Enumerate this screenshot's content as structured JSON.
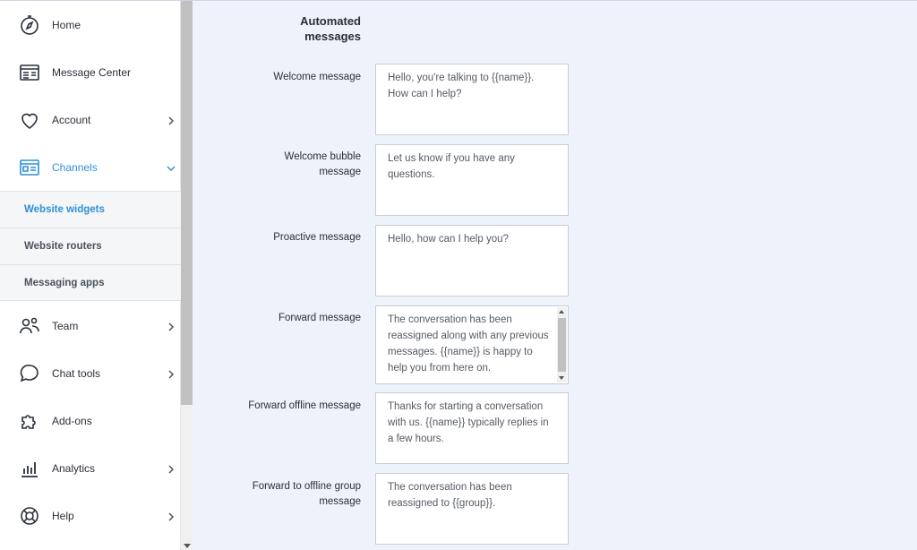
{
  "sidebar": {
    "items": [
      {
        "label": "Home",
        "icon": "compass-icon"
      },
      {
        "label": "Message Center",
        "icon": "message-center-icon"
      },
      {
        "label": "Account",
        "icon": "heart-icon"
      },
      {
        "label": "Channels",
        "icon": "channels-icon"
      },
      {
        "label": "Team",
        "icon": "team-icon"
      },
      {
        "label": "Chat tools",
        "icon": "chat-bubble-icon"
      },
      {
        "label": "Add-ons",
        "icon": "puzzle-icon"
      },
      {
        "label": "Analytics",
        "icon": "bar-chart-icon"
      },
      {
        "label": "Help",
        "icon": "lifebuoy-icon"
      }
    ],
    "channels_sub": [
      {
        "label": "Website widgets"
      },
      {
        "label": "Website routers"
      },
      {
        "label": "Messaging apps"
      }
    ]
  },
  "main": {
    "section_title_line1": "Automated",
    "section_title_line2": "messages",
    "fields": [
      {
        "label": "Welcome message",
        "value": "Hello, you're talking to {{name}}. How can I help?"
      },
      {
        "label_line1": "Welcome bubble",
        "label_line2": "message",
        "value": "Let us know if you have any questions."
      },
      {
        "label": "Proactive message",
        "value": "Hello, how can I help you?"
      },
      {
        "label": "Forward message",
        "value": "The conversation has been reassigned along with any previous messages. {{name}} is happy to help you from here on."
      },
      {
        "label": "Forward offline message",
        "value": "Thanks for starting a conversation with us. {{name}} typically replies in a few hours."
      },
      {
        "label_line1": "Forward to offline group",
        "label_line2": "message",
        "value": "The conversation has been reassigned to {{group}}."
      }
    ]
  },
  "colors": {
    "accent": "#2e8fd6",
    "background": "#eef2fa"
  }
}
